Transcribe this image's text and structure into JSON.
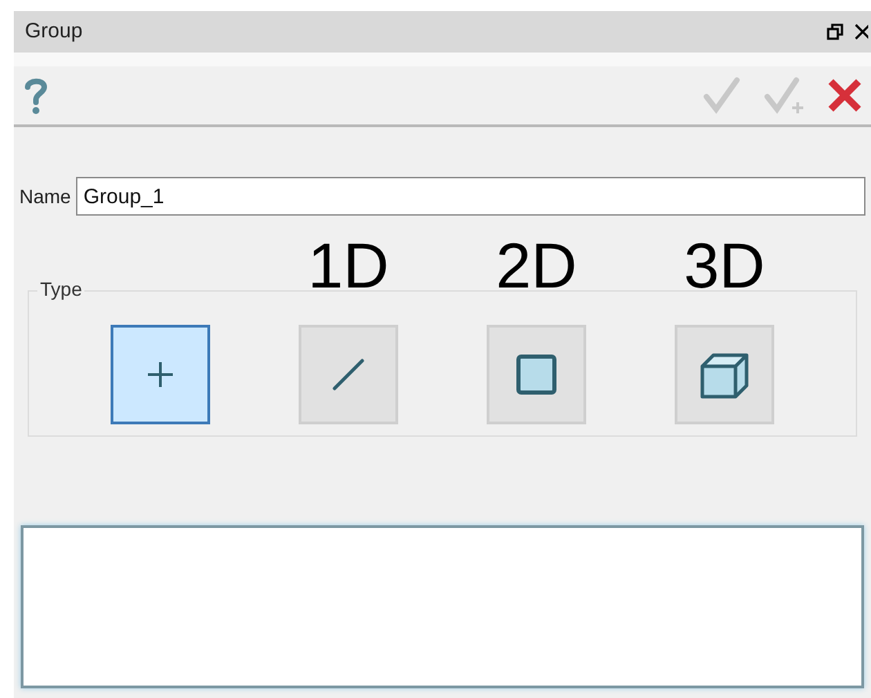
{
  "window": {
    "title": "Group"
  },
  "name_field": {
    "label": "Name",
    "value": "Group_1"
  },
  "type_group": {
    "label": "Type",
    "options": [
      {
        "kind": "point",
        "selected": true
      },
      {
        "kind": "line",
        "caption": "1D",
        "selected": false
      },
      {
        "kind": "surface",
        "caption": "2D",
        "selected": false
      },
      {
        "kind": "volume",
        "caption": "3D",
        "selected": false
      }
    ]
  }
}
